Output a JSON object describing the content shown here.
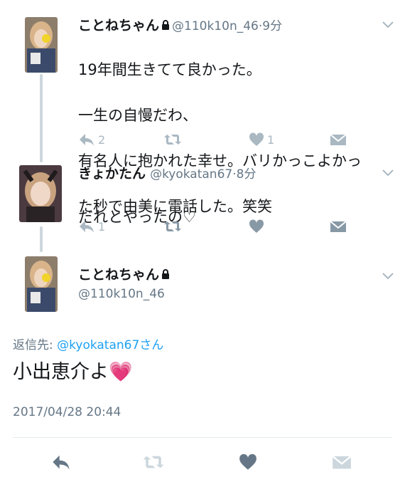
{
  "tweets": [
    {
      "name": "ことねちゃん",
      "handle": "@110k10n_46",
      "time": "9分",
      "lines": [
        "19年間生きてて良かった。",
        "一生の自慢だわ、",
        "有名人に抱かれた幸せ。バリかっこよかっ",
        "た秒で由美に電話した。笑笑"
      ],
      "reply_count": "2",
      "retweet_count": "",
      "like_count": "1"
    },
    {
      "name": "きょかたん",
      "handle": "@kyokatan67",
      "time": "8分",
      "lines": [
        "だれとやったの♡"
      ],
      "reply_count": "1",
      "retweet_count": "",
      "like_count": ""
    }
  ],
  "main_tweet": {
    "name": "ことねちゃん",
    "handle": "@110k10n_46",
    "reply_label": "返信先: ",
    "reply_handle": "@kyokatan67さん",
    "text": "小出恵介よ💗",
    "timestamp": "2017/04/28 20:44"
  },
  "icons": {
    "reply": "reply-icon",
    "retweet": "retweet-icon",
    "like": "heart-icon",
    "dm": "direct-message-icon",
    "lock": "lock-icon",
    "more": "chevron-down-icon"
  },
  "colors": {
    "icon_gray": "#aab8c2",
    "text_secondary": "#657786",
    "link_blue": "#1da1f2",
    "dark_icon": "#657786"
  }
}
